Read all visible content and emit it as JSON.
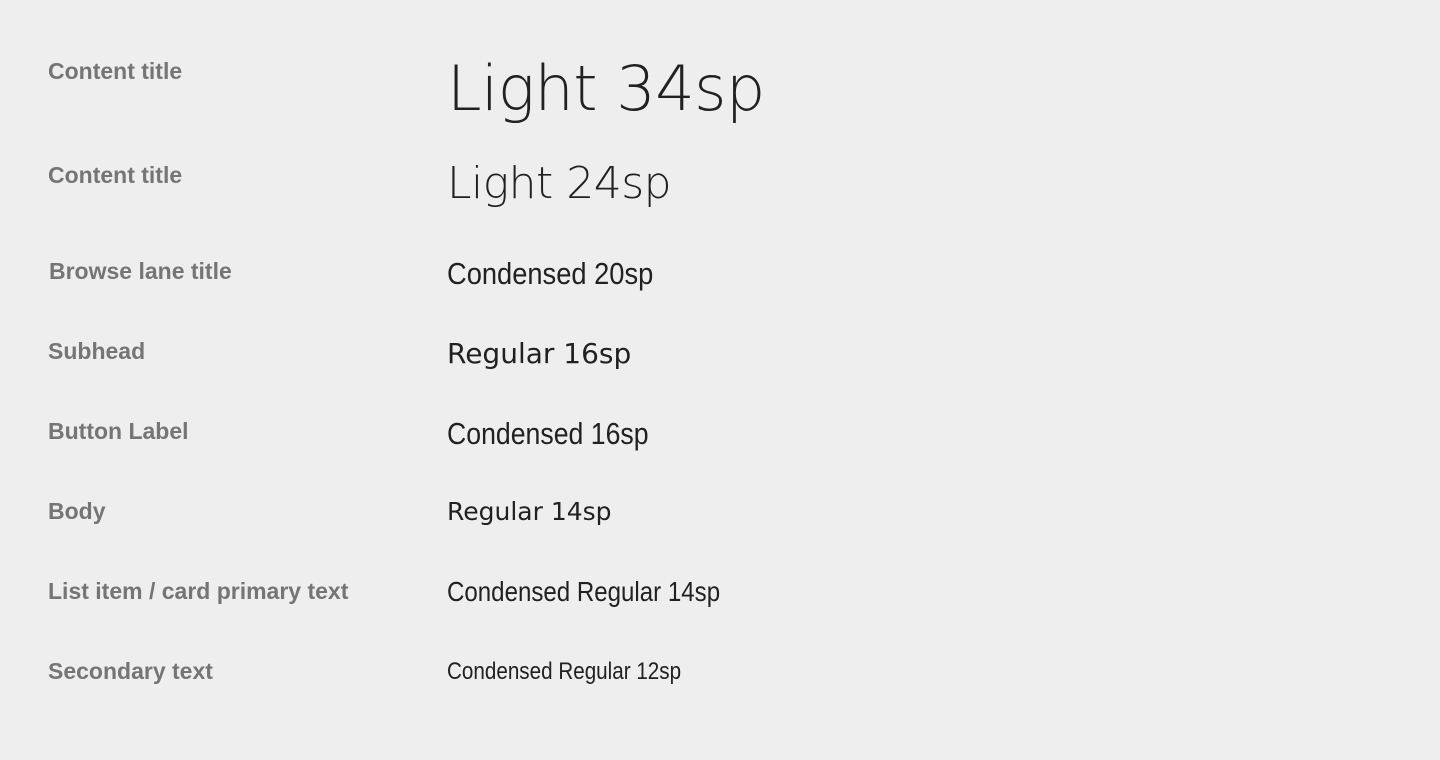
{
  "rows": [
    {
      "label": "Content title",
      "sample": "Light 34sp"
    },
    {
      "label": "Content title",
      "sample": "Light 24sp"
    },
    {
      "label": "Browse lane title",
      "sample": "Condensed 20sp"
    },
    {
      "label": "Subhead",
      "sample": "Regular 16sp"
    },
    {
      "label": "Button Label",
      "sample": "Condensed 16sp"
    },
    {
      "label": "Body",
      "sample": "Regular 14sp"
    },
    {
      "label": "List item / card primary text",
      "sample": "Condensed Regular 14sp"
    },
    {
      "label": "Secondary text",
      "sample": "Condensed Regular 12sp"
    }
  ],
  "colors": {
    "background": "#eeeeee",
    "label": "#757575",
    "sample": "#212121"
  }
}
